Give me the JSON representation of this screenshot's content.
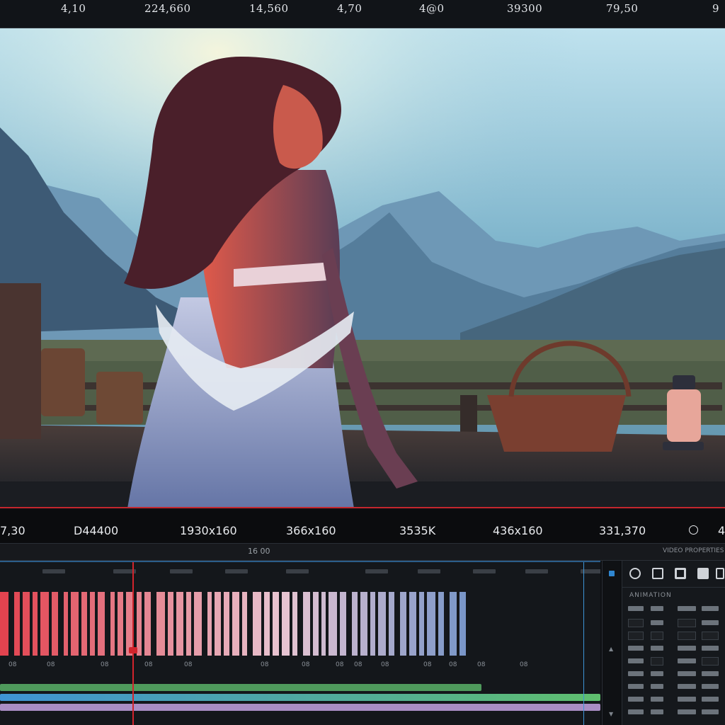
{
  "top_readouts": [
    "4,10",
    "224,660",
    "14,560",
    "4,70",
    "4@0",
    "39300",
    "79,50",
    "9"
  ],
  "info_readouts": [
    "7,30",
    "D44400",
    "1930x160",
    "366x160",
    "3535K",
    "436x160",
    "331,370",
    "4"
  ],
  "timeline": {
    "timecode": "16 00",
    "panel_label": "VIDEO PROPERTIES",
    "frame_labels": [
      "08",
      "08",
      "08",
      "08",
      "08",
      "08",
      "08",
      "08",
      "08",
      "08",
      "08",
      "08",
      "08",
      "08"
    ],
    "colors": {
      "strip_start": "#e2434f",
      "strip_mid": "#e8c5d2",
      "strip_end": "#3d7cc2",
      "track_green": "#5fb26c",
      "track_blue": "#3f93d4",
      "track_purple": "#b68fc6",
      "playhead": "#d2242c",
      "outpoint": "#3d95d6"
    }
  },
  "panel": {
    "title": "ANIMATION",
    "tool_icons": [
      "cut-icon",
      "crop-icon",
      "transition-icon",
      "file-icon",
      "settings-icon"
    ]
  },
  "accent_color": "#c4262e"
}
